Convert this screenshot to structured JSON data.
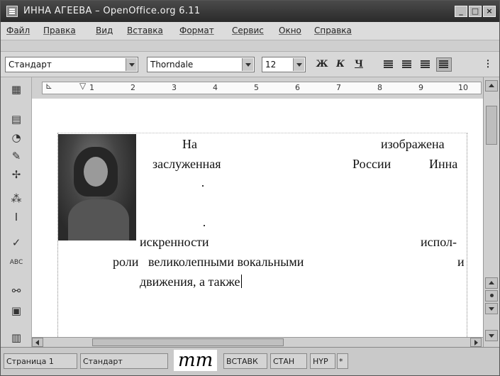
{
  "window": {
    "title": "ИННА АГЕЕВА – OpenOffice.org 6.11"
  },
  "menu": [
    "Файл",
    "Правка",
    "Вид",
    "Вставка",
    "Формат",
    "Сервис",
    "Окно",
    "Справка"
  ],
  "toolbar": {
    "style_value": "Стандарт",
    "font_value": "Thorndale",
    "size_value": "12",
    "bold": "Ж",
    "italic": "К",
    "underline": "Ч"
  },
  "ruler": {
    "marks": [
      "1",
      "2",
      "3",
      "4",
      "5",
      "6",
      "7",
      "8",
      "9",
      "10"
    ]
  },
  "document": {
    "lines": [
      {
        "w1": "На",
        "w2": "изображена"
      },
      {
        "w1": "заслуженная",
        "w2": "России",
        "w3": "Инна"
      },
      {
        "w1": "искренности",
        "w2": "испол-"
      },
      {
        "w1": "роли",
        "w2": "великолепными вокальными",
        "w3": "и"
      },
      {
        "w1": "движения, а также"
      }
    ]
  },
  "statusbar": {
    "page": "Страница  1",
    "style": "Стандарт",
    "mm": "mm",
    "insert": "ВСТАВК",
    "std": "СТАН",
    "hyp": "HYP",
    "star": "*"
  }
}
